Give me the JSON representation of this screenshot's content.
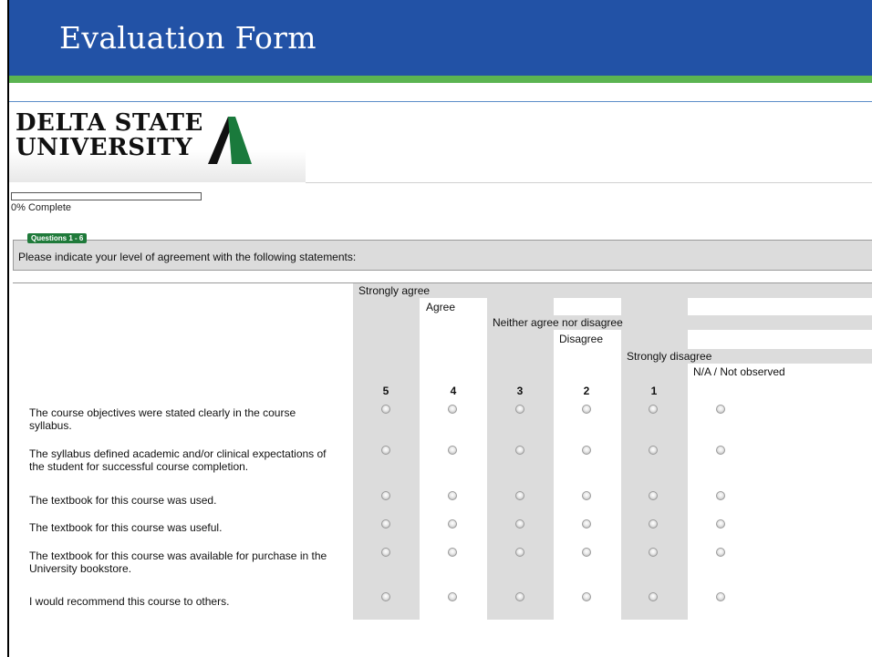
{
  "header": {
    "title": "Evaluation Form"
  },
  "logo": {
    "line1": "DELTA STATE",
    "line2": "UNIVERSITY"
  },
  "progress": {
    "percent": 0,
    "label": "0% Complete"
  },
  "section": {
    "tag": "Questions 1 - 6",
    "instruction": "Please indicate your level of agreement with the following statements:"
  },
  "scale": {
    "labels": [
      "Strongly agree",
      "Agree",
      "Neither agree nor disagree",
      "Disagree",
      "Strongly disagree",
      "N/A / Not observed"
    ],
    "values": [
      "5",
      "4",
      "3",
      "2",
      "1"
    ]
  },
  "questions": [
    "The course objectives were stated clearly in the course syllabus.",
    "The syllabus defined academic and/or clinical expectations of the student for successful course completion.",
    "The textbook for this course was used.",
    "The textbook for this course was useful.",
    "The textbook for this course was available for purchase in the University bookstore.",
    "I would recommend this course to others."
  ],
  "colors": {
    "title_bar": "#2252a6",
    "accent_green": "#5bb451",
    "tag_green": "#1f7a3a",
    "shade": "#dcdcdc"
  }
}
